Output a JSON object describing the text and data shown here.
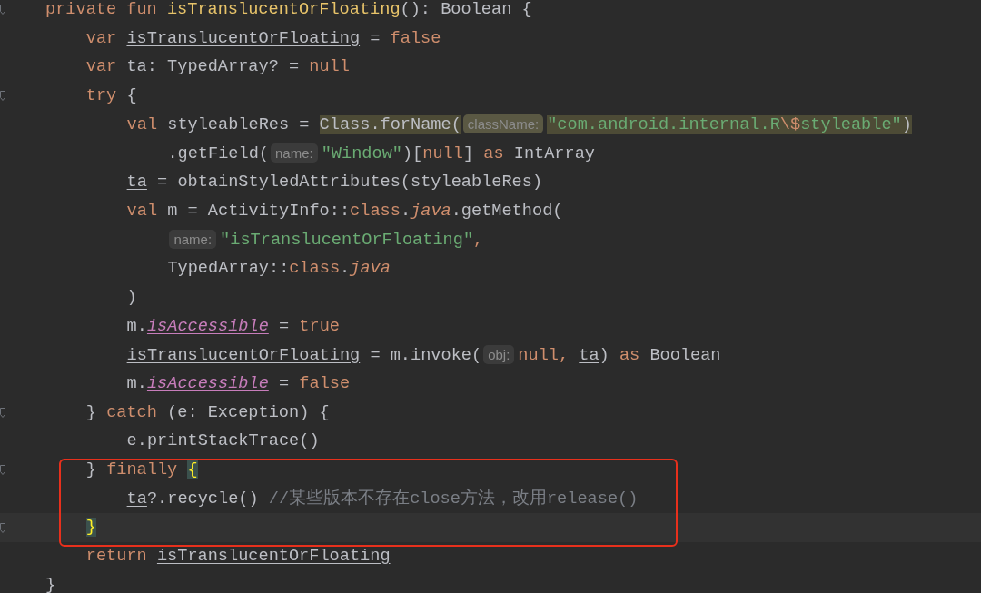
{
  "editor": {
    "lines": [
      {
        "fold_mark": true,
        "tokens": [
          {
            "kind": "keyword",
            "text": "private fun "
          },
          {
            "kind": "function",
            "text": "isTranslucentOrFloating"
          },
          {
            "kind": "plain",
            "text": "(): Boolean {"
          }
        ],
        "children": [
          {
            "tokens": [
              {
                "kind": "keyword",
                "text": "var "
              },
              {
                "kind": "local",
                "text": "isTranslucentOrFloating"
              },
              {
                "kind": "plain",
                "text": " = "
              },
              {
                "kind": "keyword",
                "text": "false"
              }
            ]
          },
          {
            "tokens": [
              {
                "kind": "keyword",
                "text": "var "
              },
              {
                "kind": "local",
                "text": "ta"
              },
              {
                "kind": "plain",
                "text": ": TypedArray? = "
              },
              {
                "kind": "keyword",
                "text": "null"
              }
            ]
          },
          {
            "fold_mark": true,
            "tokens": [
              {
                "kind": "keyword",
                "text": "try"
              },
              {
                "kind": "plain",
                "text": " {"
              }
            ],
            "children": [
              {
                "tokens": [
                  {
                    "kind": "keyword",
                    "text": "val "
                  },
                  {
                    "kind": "plain",
                    "text": "styleableRes = "
                  },
                  {
                    "kind": "plain",
                    "text": "Class.forName(",
                    "highlighted": true
                  },
                  {
                    "kind": "hint",
                    "text": "className:",
                    "highlighted": true
                  },
                  {
                    "kind": "string",
                    "text": "\"com.android.internal.R",
                    "highlighted": true
                  },
                  {
                    "kind": "escape",
                    "text": "\\$",
                    "highlighted": true
                  },
                  {
                    "kind": "string",
                    "text": "styleable\"",
                    "highlighted": true
                  },
                  {
                    "kind": "plain",
                    "text": ")",
                    "highlighted": true
                  }
                ],
                "children": [
                  {
                    "tokens": [
                      {
                        "kind": "plain",
                        "text": ".getField("
                      },
                      {
                        "kind": "hint",
                        "text": "name:"
                      },
                      {
                        "kind": "string",
                        "text": "\"Window\""
                      },
                      {
                        "kind": "plain",
                        "text": ")["
                      },
                      {
                        "kind": "keyword",
                        "text": "null"
                      },
                      {
                        "kind": "plain",
                        "text": "] "
                      },
                      {
                        "kind": "keyword",
                        "text": "as"
                      },
                      {
                        "kind": "plain",
                        "text": " IntArray"
                      }
                    ]
                  }
                ]
              },
              {
                "tokens": [
                  {
                    "kind": "local",
                    "text": "ta"
                  },
                  {
                    "kind": "plain",
                    "text": " = obtainStyledAttributes(styleableRes)"
                  }
                ]
              },
              {
                "tokens": [
                  {
                    "kind": "keyword",
                    "text": "val "
                  },
                  {
                    "kind": "plain",
                    "text": "m = ActivityInfo::"
                  },
                  {
                    "kind": "keyword",
                    "text": "class"
                  },
                  {
                    "kind": "plain",
                    "text": "."
                  },
                  {
                    "kind": "italic_keyword",
                    "text": "java"
                  },
                  {
                    "kind": "plain",
                    "text": ".getMethod("
                  }
                ],
                "children": [
                  {
                    "tokens": [
                      {
                        "kind": "hint",
                        "text": "name:"
                      },
                      {
                        "kind": "string",
                        "text": "\"isTranslucentOrFloating\""
                      },
                      {
                        "kind": "keyword",
                        "text": ","
                      }
                    ]
                  },
                  {
                    "tokens": [
                      {
                        "kind": "plain",
                        "text": "TypedArray::"
                      },
                      {
                        "kind": "keyword",
                        "text": "class"
                      },
                      {
                        "kind": "plain",
                        "text": "."
                      },
                      {
                        "kind": "italic_keyword",
                        "text": "java"
                      }
                    ]
                  }
                ]
              },
              {
                "tokens": [
                  {
                    "kind": "plain",
                    "text": ")"
                  }
                ]
              },
              {
                "tokens": [
                  {
                    "kind": "plain",
                    "text": "m."
                  },
                  {
                    "kind": "property",
                    "text": "isAccessible"
                  },
                  {
                    "kind": "plain",
                    "text": " = "
                  },
                  {
                    "kind": "keyword",
                    "text": "true"
                  }
                ]
              },
              {
                "tokens": [
                  {
                    "kind": "local",
                    "text": "isTranslucentOrFloating"
                  },
                  {
                    "kind": "plain",
                    "text": " = m.invoke("
                  },
                  {
                    "kind": "hint",
                    "text": "obj:"
                  },
                  {
                    "kind": "keyword",
                    "text": "null, "
                  },
                  {
                    "kind": "local",
                    "text": "ta"
                  },
                  {
                    "kind": "plain",
                    "text": ") "
                  },
                  {
                    "kind": "keyword",
                    "text": "as"
                  },
                  {
                    "kind": "plain",
                    "text": " Boolean"
                  }
                ]
              },
              {
                "tokens": [
                  {
                    "kind": "plain",
                    "text": "m."
                  },
                  {
                    "kind": "property",
                    "text": "isAccessible"
                  },
                  {
                    "kind": "plain",
                    "text": " = "
                  },
                  {
                    "kind": "keyword",
                    "text": "false"
                  }
                ]
              }
            ]
          },
          {
            "fold_mark": true,
            "tokens": [
              {
                "kind": "plain",
                "text": "} "
              },
              {
                "kind": "keyword",
                "text": "catch"
              },
              {
                "kind": "plain",
                "text": " (e: Exception) {"
              }
            ],
            "children": [
              {
                "tokens": [
                  {
                    "kind": "plain",
                    "text": "e.printStackTrace()"
                  }
                ]
              }
            ]
          },
          {
            "fold_mark": true,
            "boxed": true,
            "tokens": [
              {
                "kind": "plain",
                "text": "} "
              },
              {
                "kind": "keyword",
                "text": "finally "
              },
              {
                "kind": "matched_brace",
                "text": "{"
              }
            ],
            "children": [
              {
                "boxed": true,
                "tokens": [
                  {
                    "kind": "local",
                    "text": "ta"
                  },
                  {
                    "kind": "plain",
                    "text": "?.recycle() "
                  },
                  {
                    "kind": "comment",
                    "text": "//某些版本不存在close方法，改用release()"
                  }
                ]
              }
            ]
          },
          {
            "fold_mark": true,
            "boxed": true,
            "current": true,
            "tokens": [
              {
                "kind": "matched_brace",
                "text": "}"
              }
            ]
          },
          {
            "tokens": [
              {
                "kind": "keyword",
                "text": "return "
              },
              {
                "kind": "local",
                "text": "isTranslucentOrFloating"
              }
            ]
          }
        ]
      },
      {
        "tokens": [
          {
            "kind": "plain",
            "text": "}"
          }
        ]
      }
    ]
  }
}
